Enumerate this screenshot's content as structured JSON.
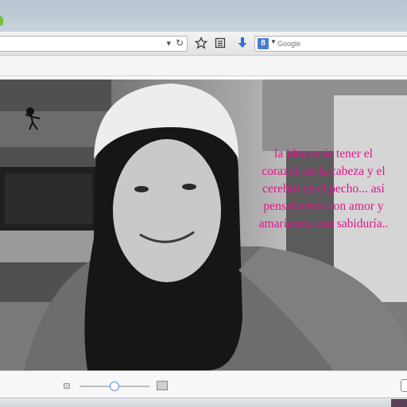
{
  "browser": {
    "search": {
      "engine_icon": "google-icon",
      "engine_letter": "8",
      "placeholder": "Google"
    },
    "icons": [
      "chevron-down-icon",
      "reload-icon",
      "star-icon",
      "reading-list-icon",
      "download-arrow-icon",
      "addon-icon"
    ]
  },
  "viewer": {
    "caption": [
      "la idea sería tener el",
      "corazón en la cabeza y el",
      "cerebro en el pecho... así",
      "pensaríamos con amor y",
      "amaríamos con sabiduría.."
    ],
    "caption_color": "#e0148c",
    "zoom_level": 0.5
  }
}
